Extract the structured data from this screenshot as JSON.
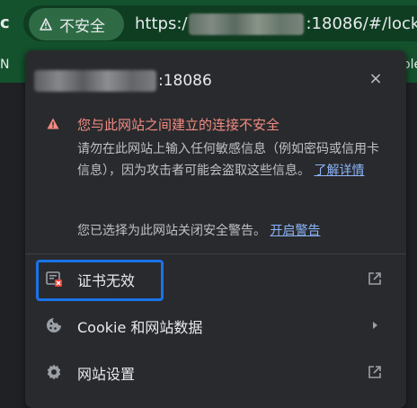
{
  "browser": {
    "reload_glyph": "c",
    "security_chip_label": "不安全",
    "url_prefix": "https:/",
    "url_suffix": ":18086/#/lock",
    "bookmark_left": "N",
    "bookmark_right": "ole"
  },
  "popup": {
    "host_port": ":18086",
    "close_glyph": "×",
    "warning_title": "您与此网站之间建立的连接不安全",
    "warning_desc": "请勿在此网站上输入任何敏感信息（例如密码或信用卡信息），因为攻击者可能会盗取这些信息。",
    "learn_more": "了解详情",
    "choice_text": "您已选择为此网站关闭安全警告。",
    "choice_link": "开启警告",
    "menu": [
      {
        "label": "证书无效",
        "icon": "certificate-icon",
        "trailing": "external-link-icon"
      },
      {
        "label": "Cookie 和网站数据",
        "icon": "cookie-icon",
        "trailing": "chevron-right-icon"
      },
      {
        "label": "网站设置",
        "icon": "gear-icon",
        "trailing": "external-link-icon"
      }
    ]
  },
  "colors": {
    "toolbar": "#14522d",
    "popup_bg": "#292a2d",
    "warning": "#f28b82",
    "link": "#8ab4f8",
    "focus": "#1a73e8"
  }
}
